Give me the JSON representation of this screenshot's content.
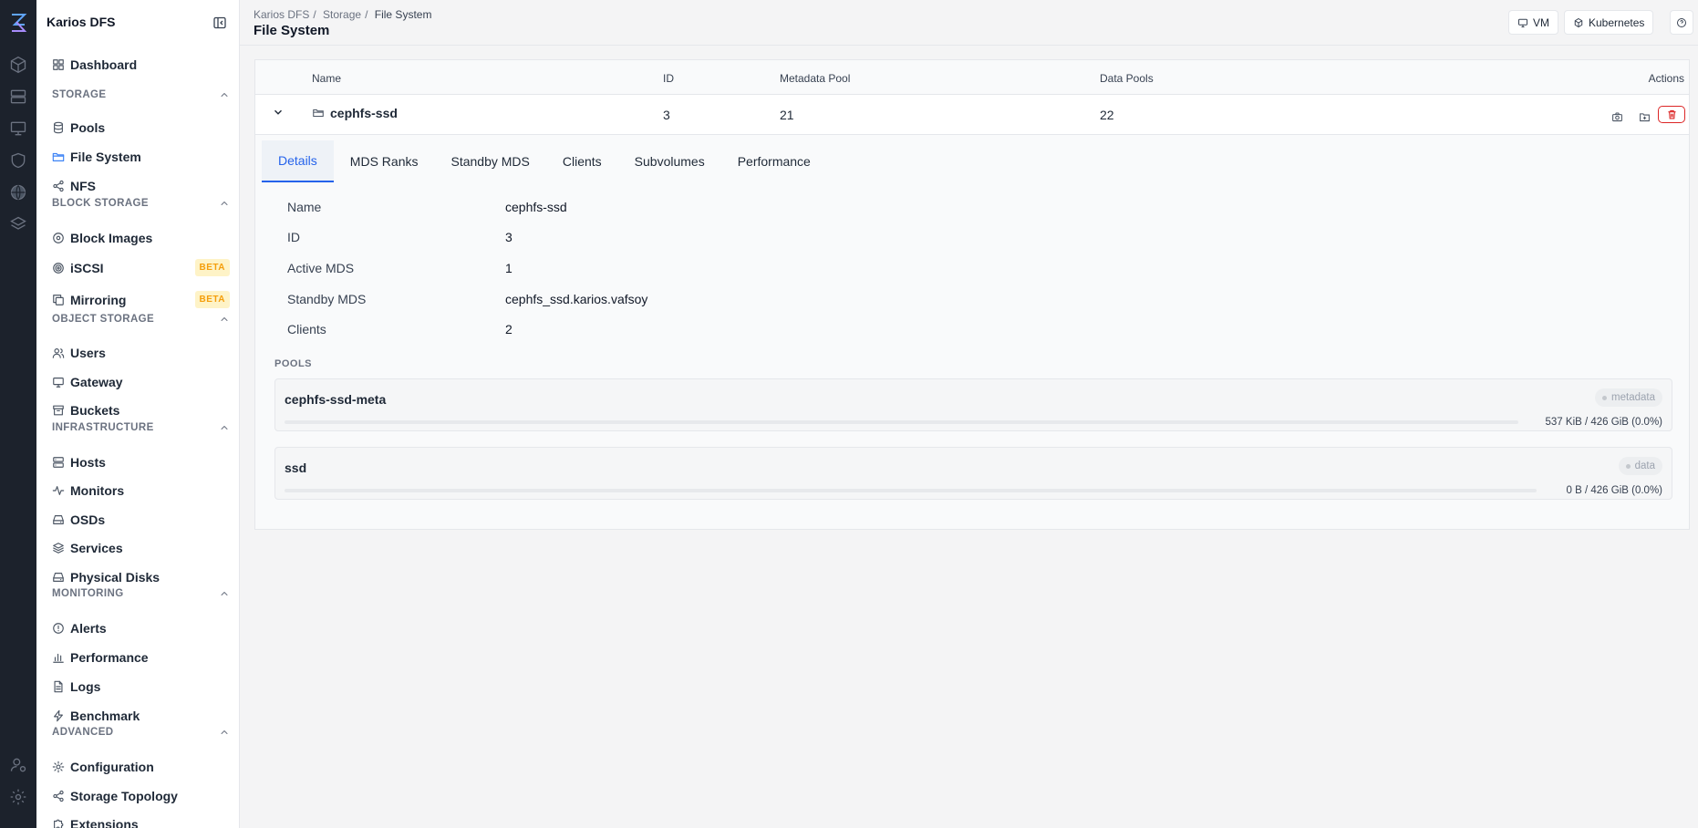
{
  "app": {
    "name": "Karios DFS"
  },
  "breadcrumb": [
    "Karios DFS",
    "Storage",
    "File System"
  ],
  "page_title": "File System",
  "header_buttons": {
    "vm": "VM",
    "kubernetes": "Kubernetes"
  },
  "sidebar": {
    "top": [
      {
        "label": "Dashboard",
        "icon": "dashboard-icon"
      }
    ],
    "sections": [
      {
        "title": "STORAGE",
        "items": [
          {
            "label": "Pools",
            "icon": "database-icon"
          },
          {
            "label": "File System",
            "icon": "folder-icon",
            "active": true
          },
          {
            "label": "NFS",
            "icon": "share-icon"
          }
        ]
      },
      {
        "title": "BLOCK STORAGE",
        "items": [
          {
            "label": "Block Images",
            "icon": "disk-icon"
          },
          {
            "label": "iSCSI",
            "icon": "target-icon",
            "badge": "BETA"
          },
          {
            "label": "Mirroring",
            "icon": "copy-icon",
            "badge": "BETA"
          }
        ]
      },
      {
        "title": "OBJECT STORAGE",
        "items": [
          {
            "label": "Users",
            "icon": "users-icon"
          },
          {
            "label": "Gateway",
            "icon": "monitor-icon"
          },
          {
            "label": "Buckets",
            "icon": "archive-icon"
          }
        ]
      },
      {
        "title": "INFRASTRUCTURE",
        "items": [
          {
            "label": "Hosts",
            "icon": "server-icon"
          },
          {
            "label": "Monitors",
            "icon": "activity-icon"
          },
          {
            "label": "OSDs",
            "icon": "hard-drive-icon"
          },
          {
            "label": "Services",
            "icon": "layers-icon"
          },
          {
            "label": "Physical Disks",
            "icon": "hard-drive-icon"
          }
        ]
      },
      {
        "title": "MONITORING",
        "items": [
          {
            "label": "Alerts",
            "icon": "alert-icon"
          },
          {
            "label": "Performance",
            "icon": "bar-chart-icon"
          },
          {
            "label": "Logs",
            "icon": "file-text-icon"
          },
          {
            "label": "Benchmark",
            "icon": "zap-icon"
          }
        ]
      },
      {
        "title": "ADVANCED",
        "items": [
          {
            "label": "Configuration",
            "icon": "gear-icon"
          },
          {
            "label": "Storage Topology",
            "icon": "share-icon"
          },
          {
            "label": "Extensions",
            "icon": "puzzle-icon"
          }
        ]
      }
    ]
  },
  "table": {
    "columns": {
      "name": "Name",
      "id": "ID",
      "metadata_pool": "Metadata Pool",
      "data_pools": "Data Pools",
      "actions": "Actions"
    },
    "row": {
      "name": "cephfs-ssd",
      "id": "3",
      "metadata_pool": "21",
      "data_pools": "22"
    }
  },
  "tabs": [
    "Details",
    "MDS Ranks",
    "Standby MDS",
    "Clients",
    "Subvolumes",
    "Performance"
  ],
  "active_tab": "Details",
  "details": [
    {
      "label": "Name",
      "value": "cephfs-ssd"
    },
    {
      "label": "ID",
      "value": "3"
    },
    {
      "label": "Active MDS",
      "value": "1"
    },
    {
      "label": "Standby MDS",
      "value": "cephfs_ssd.karios.vafsoy"
    },
    {
      "label": "Clients",
      "value": "2"
    }
  ],
  "pools_title": "POOLS",
  "pools": [
    {
      "name": "cephfs-ssd-meta",
      "tag": "metadata",
      "usage": "537 KiB / 426 GiB (0.0%)",
      "used_fraction": 0.0
    },
    {
      "name": "ssd",
      "tag": "data",
      "usage": "0 B / 426 GiB (0.0%)",
      "used_fraction": 0.0
    }
  ],
  "colors": {
    "accent": "#2563eb",
    "rail_bg": "#1c222c",
    "danger": "#dc2626",
    "beta": "#f59e0b"
  }
}
